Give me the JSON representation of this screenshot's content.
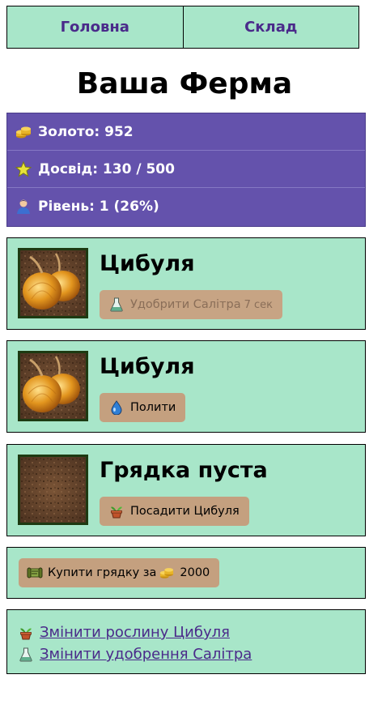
{
  "nav": {
    "tabs": [
      {
        "label": "Головна"
      },
      {
        "label": "Склад"
      }
    ]
  },
  "page_title": "Ваша Ферма",
  "stats": {
    "gold": "Золото: 952",
    "experience": "Досвід: 130 / 500",
    "level": "Рівень: 1 (26%)"
  },
  "plots": [
    {
      "name": "Цибуля",
      "image": "onion-plot",
      "action": {
        "label": "Удобрити Салітра",
        "icon": "flask-icon",
        "timer": "7 сек",
        "disabled": true
      }
    },
    {
      "name": "Цибуля",
      "image": "onion-plot",
      "action": {
        "label": "Полити",
        "icon": "water-drop-icon",
        "disabled": false
      }
    },
    {
      "name": "Грядка пуста",
      "image": "empty-soil",
      "action": {
        "label": "Посадити Цибуля",
        "icon": "sprout-pot-icon",
        "disabled": false
      }
    }
  ],
  "buy": {
    "label": "Купити грядку за",
    "price": "2000"
  },
  "links": {
    "change_plant": "Змінити рослину Цибуля",
    "change_fertilizer": "Змінити удобрення Салітра"
  },
  "colors": {
    "accent_green": "#a8e6c9",
    "stats_purple": "#6452ac",
    "button_tan": "#c4a07f",
    "link_purple": "#4a2a8a"
  }
}
